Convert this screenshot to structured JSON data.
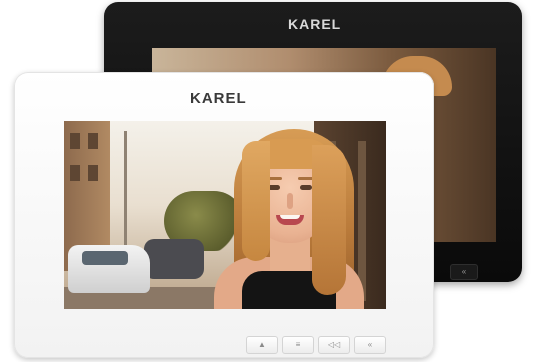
{
  "back_monitor": {
    "brand": "KAREL",
    "color": "#0f0f0f",
    "buttons": [
      {
        "icon": "speaker-icon",
        "glyph": "«"
      }
    ]
  },
  "front_monitor": {
    "brand": "KAREL",
    "color": "#f7f7f7",
    "buttons": [
      {
        "icon": "unlock-icon",
        "glyph": "▲"
      },
      {
        "icon": "menu-icon",
        "glyph": "≡"
      },
      {
        "icon": "monitor-icon",
        "glyph": "◁◁"
      },
      {
        "icon": "speaker-icon",
        "glyph": "«"
      }
    ]
  }
}
